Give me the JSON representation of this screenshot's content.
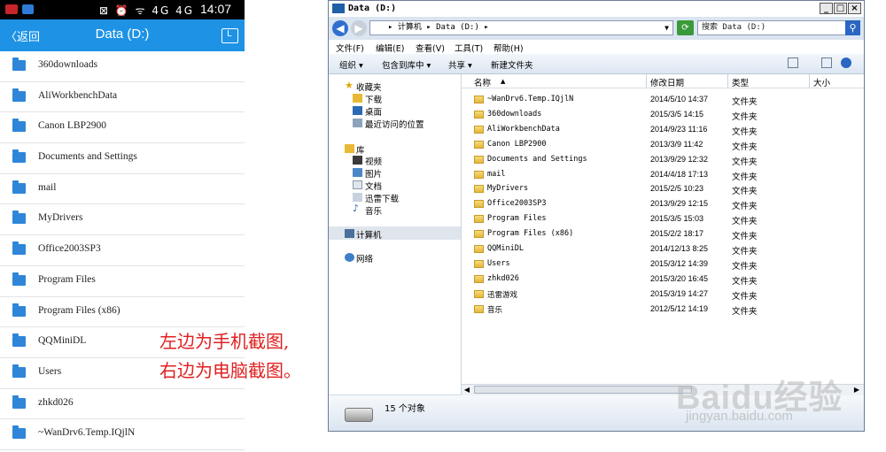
{
  "phone": {
    "status_time": "14:07",
    "status_icons": "⊠ ⏰ ᯤ 4G 4G",
    "back_label": "〈返回",
    "title": "Data (D:)",
    "items": [
      "360downloads",
      "AliWorkbenchData",
      "Canon LBP2900",
      "Documents and Settings",
      "mail",
      "MyDrivers",
      "Office2003SP3",
      "Program Files",
      "Program Files (x86)",
      "QQMiniDL",
      "Users",
      "zhkd026",
      "~WanDrv6.Temp.IQjlN"
    ]
  },
  "caption": {
    "line1": "左边为手机截图,",
    "line2": "右边为电脑截图。"
  },
  "window": {
    "title": "Data (D:)",
    "controls": [
      "_",
      "□",
      "×"
    ],
    "address_path": "▸ 计算机 ▸ Data (D:) ▸",
    "search_placeholder": "搜索 Data (D:)",
    "menus": [
      "文件(F)",
      "编辑(E)",
      "查看(V)",
      "工具(T)",
      "帮助(H)"
    ],
    "toolbar": [
      "组织 ▾",
      "包含到库中 ▾",
      "共享 ▾",
      "新建文件夹"
    ],
    "nav": {
      "favorites": "收藏夹",
      "fav_items": [
        "下载",
        "桌面",
        "最近访问的位置"
      ],
      "library": "库",
      "lib_items": [
        "视频",
        "图片",
        "文档",
        "迅雷下载",
        "音乐"
      ],
      "computer": "计算机",
      "network": "网络"
    },
    "columns": [
      "名称",
      "修改日期",
      "类型",
      "大小"
    ],
    "files": [
      {
        "name": "~WanDrv6.Temp.IQjlN",
        "date": "2014/5/10 14:37",
        "type": "文件夹"
      },
      {
        "name": "360downloads",
        "date": "2015/3/5 14:15",
        "type": "文件夹"
      },
      {
        "name": "AliWorkbenchData",
        "date": "2014/9/23 11:16",
        "type": "文件夹"
      },
      {
        "name": "Canon LBP2900",
        "date": "2013/3/9 11:42",
        "type": "文件夹"
      },
      {
        "name": "Documents and Settings",
        "date": "2013/9/29 12:32",
        "type": "文件夹"
      },
      {
        "name": "mail",
        "date": "2014/4/18 17:13",
        "type": "文件夹"
      },
      {
        "name": "MyDrivers",
        "date": "2015/2/5 10:23",
        "type": "文件夹"
      },
      {
        "name": "Office2003SP3",
        "date": "2013/9/29 12:15",
        "type": "文件夹"
      },
      {
        "name": "Program Files",
        "date": "2015/3/5 15:03",
        "type": "文件夹"
      },
      {
        "name": "Program Files (x86)",
        "date": "2015/2/2 18:17",
        "type": "文件夹"
      },
      {
        "name": "QQMiniDL",
        "date": "2014/12/13 8:25",
        "type": "文件夹"
      },
      {
        "name": "Users",
        "date": "2015/3/12 14:39",
        "type": "文件夹"
      },
      {
        "name": "zhkd026",
        "date": "2015/3/20 16:45",
        "type": "文件夹"
      },
      {
        "name": "迅雷游戏",
        "date": "2015/3/19 14:27",
        "type": "文件夹"
      },
      {
        "name": "音乐",
        "date": "2012/5/12 14:19",
        "type": "文件夹"
      }
    ],
    "object_count": "15 个对象"
  },
  "watermark": {
    "logo": "Baidu经验",
    "url": "jingyan.baidu.com"
  }
}
